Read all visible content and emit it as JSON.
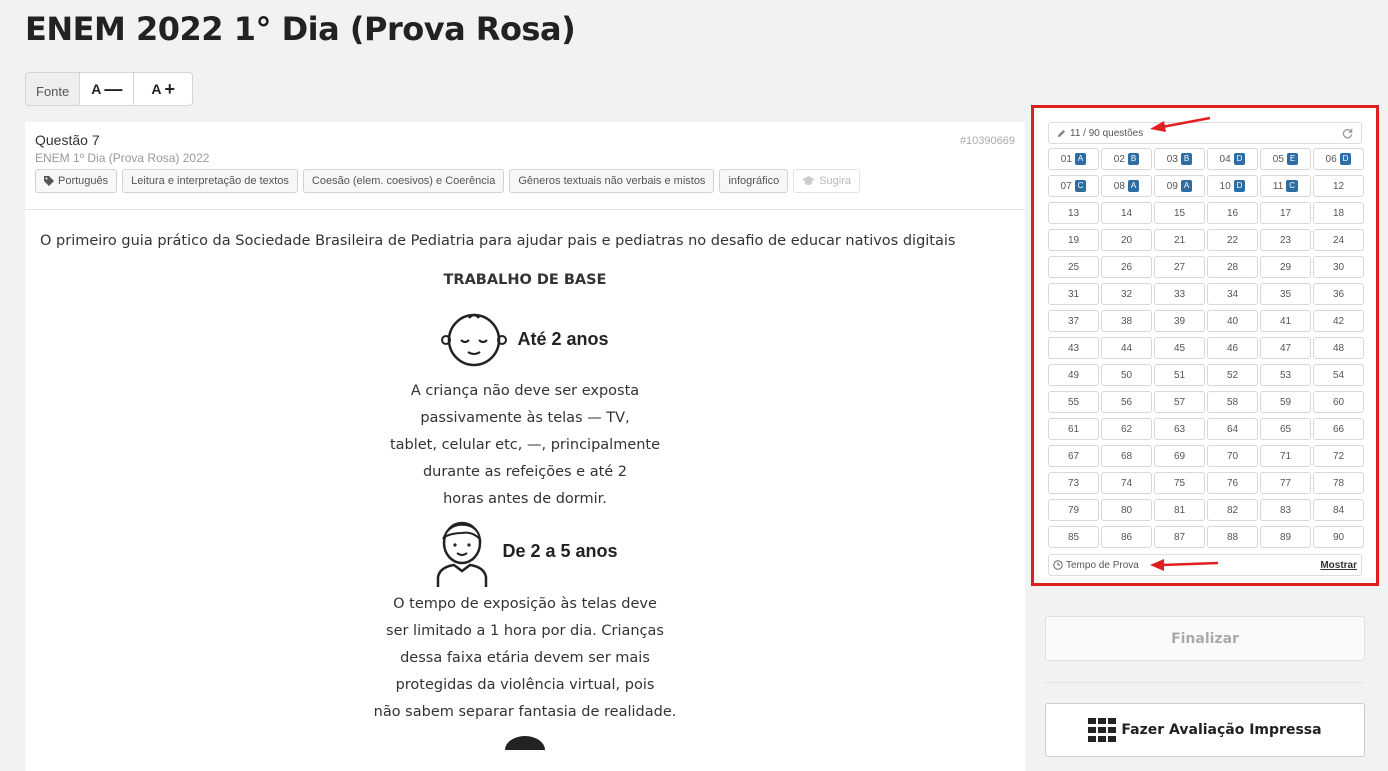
{
  "page": {
    "title": "ENEM 2022 1° Dia (Prova Rosa)"
  },
  "font_toolbar": {
    "label": "Fonte",
    "decrease_label": "A",
    "increase_label": "A"
  },
  "question": {
    "title": "Questão 7",
    "subtitle": "ENEM 1º Dia (Prova Rosa) 2022",
    "id": "#10390669",
    "tags": [
      "Português",
      "Leitura e interpretação de textos",
      "Coesão (elem. coesivos) e Coerência",
      "Gêneros textuais não verbais e mistos",
      "infográfico"
    ],
    "suggest_label": "Sugira",
    "intro": "O primeiro guia prático da Sociedade Brasileira de Pediatria para ajudar pais e pediatras no desafio de educar nativos digitais",
    "heading": "TRABALHO DE BASE",
    "age1": "Até 2 anos",
    "para1": [
      "A criança não deve ser exposta",
      "passivamente às telas — TV,",
      "tablet, celular etc, —, principalmente",
      "durante as refeições e até 2",
      "horas antes de dormir."
    ],
    "age2": "De 2 a 5 anos",
    "para2": [
      "O tempo de exposição às telas deve",
      "ser limitado a 1 hora por dia. Crianças",
      "dessa faixa etária devem ser mais",
      "protegidas da violência virtual, pois",
      "não sabem separar fantasia de realidade."
    ]
  },
  "panel": {
    "counter": "11 / 90 questões",
    "answered": [
      {
        "n": "01",
        "a": "A"
      },
      {
        "n": "02",
        "a": "B"
      },
      {
        "n": "03",
        "a": "B"
      },
      {
        "n": "04",
        "a": "D"
      },
      {
        "n": "05",
        "a": "E"
      },
      {
        "n": "06",
        "a": "D"
      },
      {
        "n": "07",
        "a": "C"
      },
      {
        "n": "08",
        "a": "A"
      },
      {
        "n": "09",
        "a": "A"
      },
      {
        "n": "10",
        "a": "D"
      },
      {
        "n": "11",
        "a": "C"
      }
    ],
    "total": 90,
    "timer_label": "Tempo de Prova",
    "timer_show": "Mostrar"
  },
  "buttons": {
    "finalize": "Finalizar",
    "print": "Fazer Avaliação Impressa"
  },
  "colors": {
    "annotation": "#e02020",
    "badge": "#2e6da4"
  }
}
